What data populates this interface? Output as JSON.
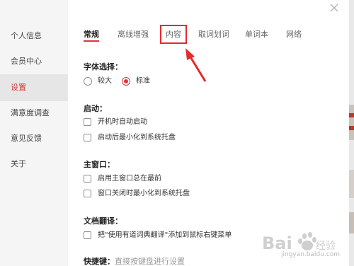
{
  "sidebar": {
    "items": [
      {
        "label": "个人信息",
        "active": false
      },
      {
        "label": "会员中心",
        "active": false
      },
      {
        "label": "设置",
        "active": true
      },
      {
        "label": "满意度调查",
        "active": false
      },
      {
        "label": "意见反馈",
        "active": false
      },
      {
        "label": "关于",
        "active": false
      }
    ]
  },
  "close_icon": "close-icon",
  "tabs": [
    {
      "label": "常规",
      "active": true
    },
    {
      "label": "离线增强",
      "active": false
    },
    {
      "label": "内容",
      "active": false,
      "highlighted": true
    },
    {
      "label": "取词划词",
      "active": false
    },
    {
      "label": "单词本",
      "active": false
    },
    {
      "label": "网络",
      "active": false
    }
  ],
  "font_section": {
    "title": "字体选择：",
    "options": [
      {
        "label": "较大",
        "checked": false
      },
      {
        "label": "标准",
        "checked": true
      }
    ]
  },
  "startup_section": {
    "title": "启动：",
    "options": [
      {
        "label": "开机时自动启动",
        "checked": false
      },
      {
        "label": "启动后最小化到系统托盘",
        "checked": false
      }
    ]
  },
  "main_window_section": {
    "title": "主窗口：",
    "options": [
      {
        "label": "启用主窗口总在最前",
        "checked": false
      },
      {
        "label": "窗口关闭时最小化到系统托盘",
        "checked": false
      }
    ]
  },
  "doc_translate_section": {
    "title": "文档翻译：",
    "options": [
      {
        "label": "把\"使用有道词典翻译\"添加到鼠标右键菜单",
        "checked": false
      }
    ]
  },
  "shortcut_section": {
    "title": "快捷键：",
    "subtitle": "直接按键盘进行设置"
  },
  "watermark": {
    "text": "jingyan.baidu.com"
  },
  "colors": {
    "accent": "#d8373b",
    "highlight_box": "#e52b2b",
    "sidebar_bg": "#f5f5f5"
  }
}
